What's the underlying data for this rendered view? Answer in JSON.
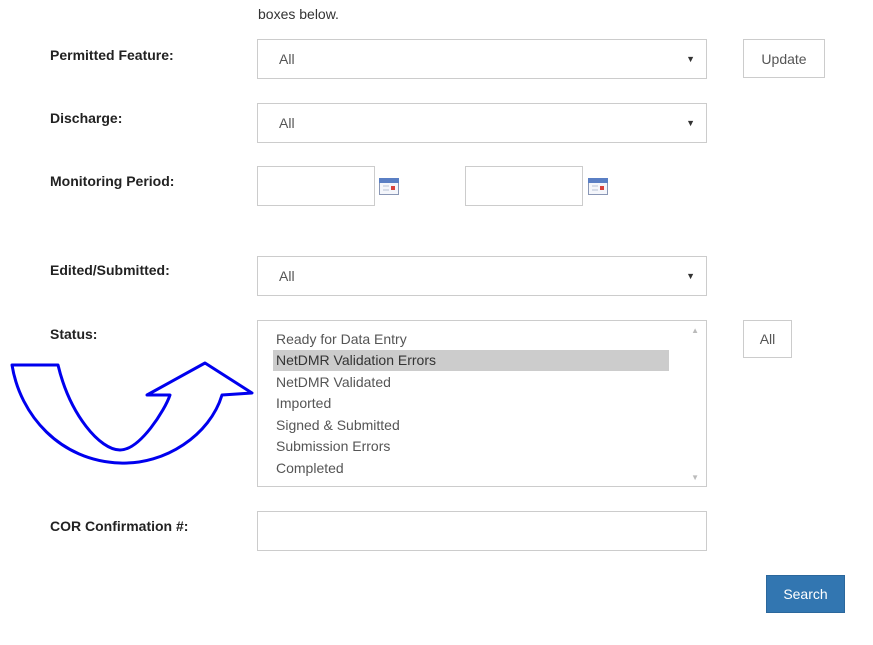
{
  "intro_text": "boxes below.",
  "permitted_feature": {
    "label": "Permitted Feature:",
    "value": "All",
    "update_label": "Update"
  },
  "discharge": {
    "label": "Discharge:",
    "value": "All"
  },
  "monitoring_period": {
    "label": "Monitoring Period:",
    "start_value": "",
    "end_value": ""
  },
  "edited_submitted": {
    "label": "Edited/Submitted:",
    "value": "All"
  },
  "status": {
    "label": "Status:",
    "all_label": "All",
    "options": [
      "Ready for Data Entry",
      "NetDMR Validation Errors",
      "NetDMR Validated",
      "Imported",
      "Signed & Submitted",
      "Submission Errors",
      "Completed"
    ],
    "selected": "NetDMR Validation Errors"
  },
  "cor_confirmation": {
    "label": "COR Confirmation #:",
    "value": ""
  },
  "search_label": "Search",
  "colors": {
    "accent": "#3276b1",
    "arrow": "#0000ee",
    "selected_bg": "#cccccc",
    "border": "#cccccc"
  },
  "icons": {
    "dropdown": "caret-down-icon",
    "calendar": "calendar-icon",
    "annotation": "curved-arrow-icon"
  }
}
